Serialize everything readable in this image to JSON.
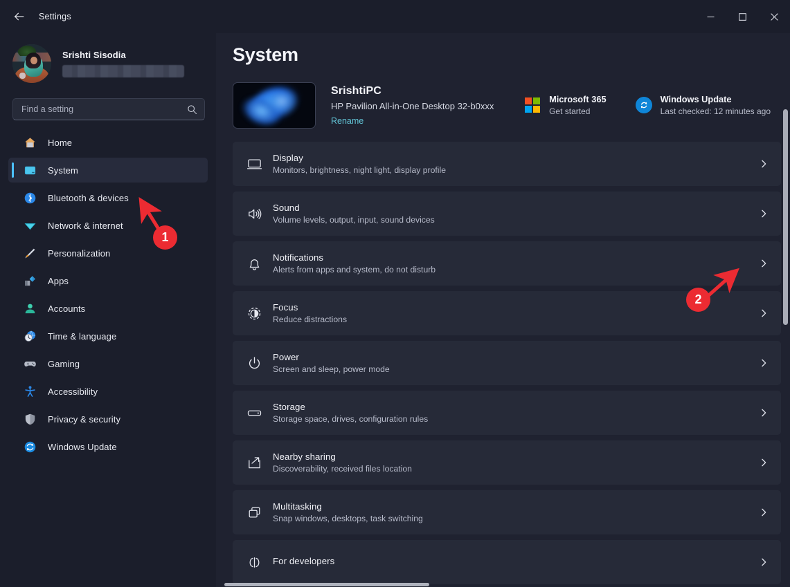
{
  "titlebar": {
    "back_label": "back-arrow",
    "title": "Settings",
    "minimize": "minimize",
    "maximize": "maximize",
    "close": "close"
  },
  "sidebar": {
    "profile": {
      "name": "Srishti Sisodia",
      "email_masked": ""
    },
    "search": {
      "placeholder": "Find a setting",
      "value": ""
    },
    "items": [
      {
        "label": "Home",
        "icon": "home-icon",
        "selected": false
      },
      {
        "label": "System",
        "icon": "system-icon",
        "selected": true
      },
      {
        "label": "Bluetooth & devices",
        "icon": "bluetooth-icon",
        "selected": false
      },
      {
        "label": "Network & internet",
        "icon": "network-icon",
        "selected": false
      },
      {
        "label": "Personalization",
        "icon": "personalization-icon",
        "selected": false
      },
      {
        "label": "Apps",
        "icon": "apps-icon",
        "selected": false
      },
      {
        "label": "Accounts",
        "icon": "accounts-icon",
        "selected": false
      },
      {
        "label": "Time & language",
        "icon": "time-language-icon",
        "selected": false
      },
      {
        "label": "Gaming",
        "icon": "gaming-icon",
        "selected": false
      },
      {
        "label": "Accessibility",
        "icon": "accessibility-icon",
        "selected": false
      },
      {
        "label": "Privacy & security",
        "icon": "privacy-security-icon",
        "selected": false
      },
      {
        "label": "Windows Update",
        "icon": "windows-update-icon",
        "selected": false
      }
    ]
  },
  "content": {
    "page_title": "System",
    "device": {
      "name": "SrishtiPC",
      "model": "HP Pavilion All-in-One Desktop 32-b0xxx",
      "rename_label": "Rename"
    },
    "hero_cards": [
      {
        "title": "Microsoft 365",
        "subtitle": "Get started",
        "icon": "microsoft-logo-icon"
      },
      {
        "title": "Windows Update",
        "subtitle": "Last checked: 12 minutes ago",
        "icon": "sync-refresh-icon"
      }
    ],
    "settings": [
      {
        "title": "Display",
        "subtitle": "Monitors, brightness, night light, display profile",
        "icon": "monitor-icon"
      },
      {
        "title": "Sound",
        "subtitle": "Volume levels, output, input, sound devices",
        "icon": "speaker-icon"
      },
      {
        "title": "Notifications",
        "subtitle": "Alerts from apps and system, do not disturb",
        "icon": "bell-icon"
      },
      {
        "title": "Focus",
        "subtitle": "Reduce distractions",
        "icon": "focus-icon"
      },
      {
        "title": "Power",
        "subtitle": "Screen and sleep, power mode",
        "icon": "power-icon"
      },
      {
        "title": "Storage",
        "subtitle": "Storage space, drives, configuration rules",
        "icon": "drive-icon"
      },
      {
        "title": "Nearby sharing",
        "subtitle": "Discoverability, received files location",
        "icon": "share-icon"
      },
      {
        "title": "Multitasking",
        "subtitle": "Snap windows, desktops, task switching",
        "icon": "windows-stack-icon"
      },
      {
        "title": "For developers",
        "subtitle": "",
        "icon": "developer-icon"
      }
    ]
  },
  "annotations": [
    {
      "label": "1",
      "target": "sidebar-item-system"
    },
    {
      "label": "2",
      "target": "row-chevron-notifications"
    }
  ],
  "colors": {
    "accent": "#4cc2ff",
    "annotation_red": "#ec2b32",
    "link": "#63c6d8",
    "window_bg": "#1f2230",
    "sidebar_bg": "#1b1e2b",
    "card_bg": "#262a38"
  }
}
